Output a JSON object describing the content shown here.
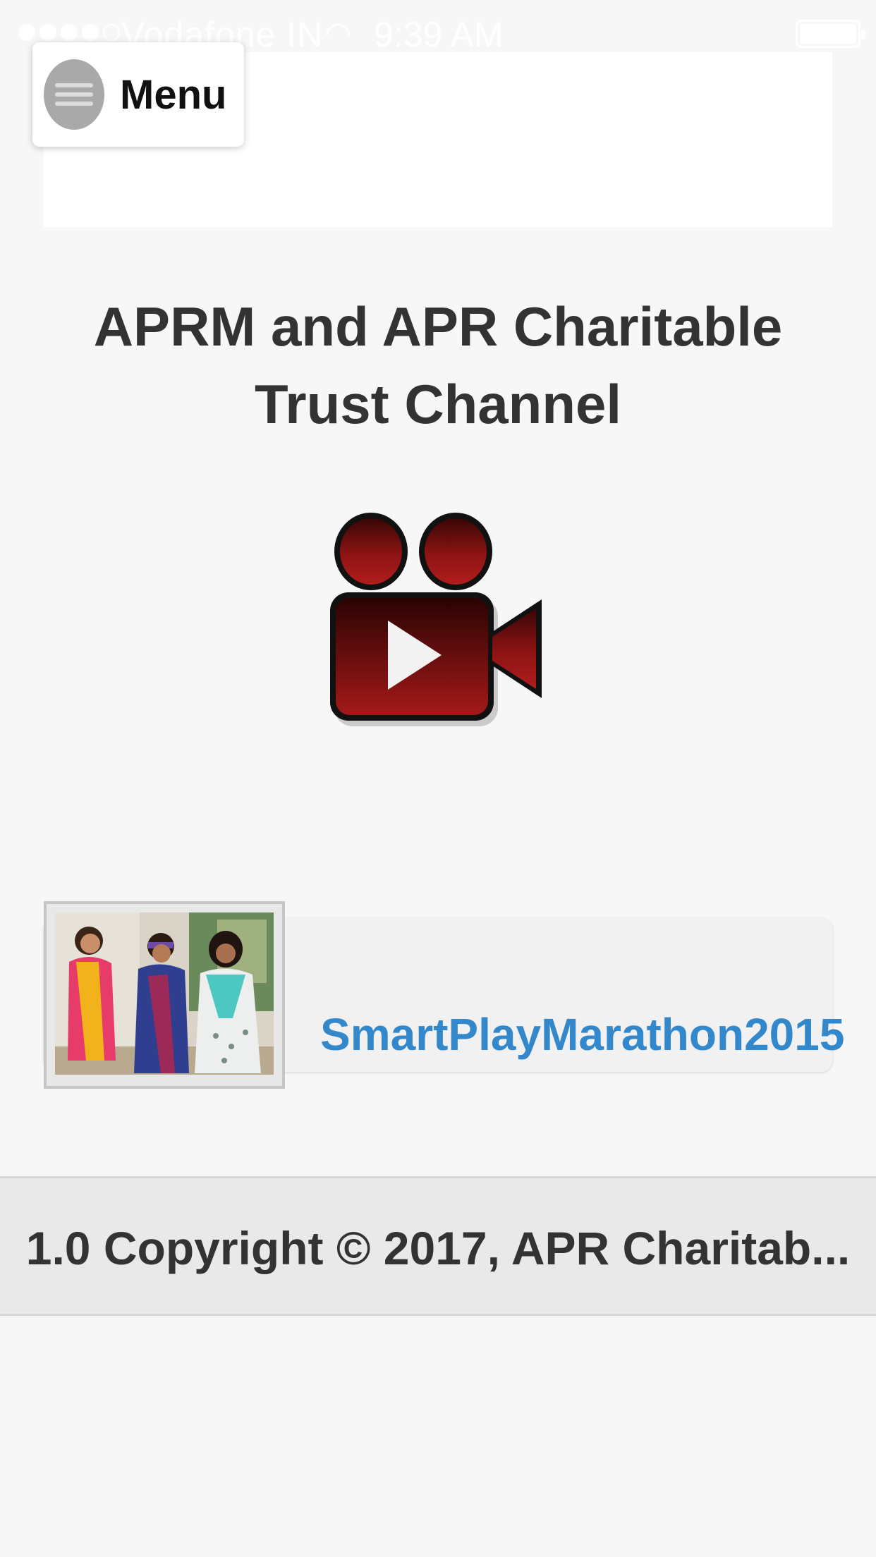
{
  "status_bar": {
    "carrier": "Vodafone IN",
    "time": "9:39 AM",
    "signal_bars_filled": 4,
    "signal_bars_total": 5,
    "battery_level": 1.0
  },
  "header": {
    "menu_label": "Menu",
    "menu_icon": "hamburger-menu-icon"
  },
  "main": {
    "title_line1": "APRM and APR Charitable",
    "title_line2": "Trust Channel",
    "channel_icon": "video-camera-play-icon"
  },
  "videos": [
    {
      "label": "SmartPlayMarathon2015",
      "thumbnail": "photo-of-three-women"
    }
  ],
  "footer": {
    "text": "1.0 Copyright © 2017, APR Charitab..."
  },
  "colors": {
    "link": "#3388cc",
    "camera_red": "#8b1414",
    "background": "#f7f7f7"
  }
}
